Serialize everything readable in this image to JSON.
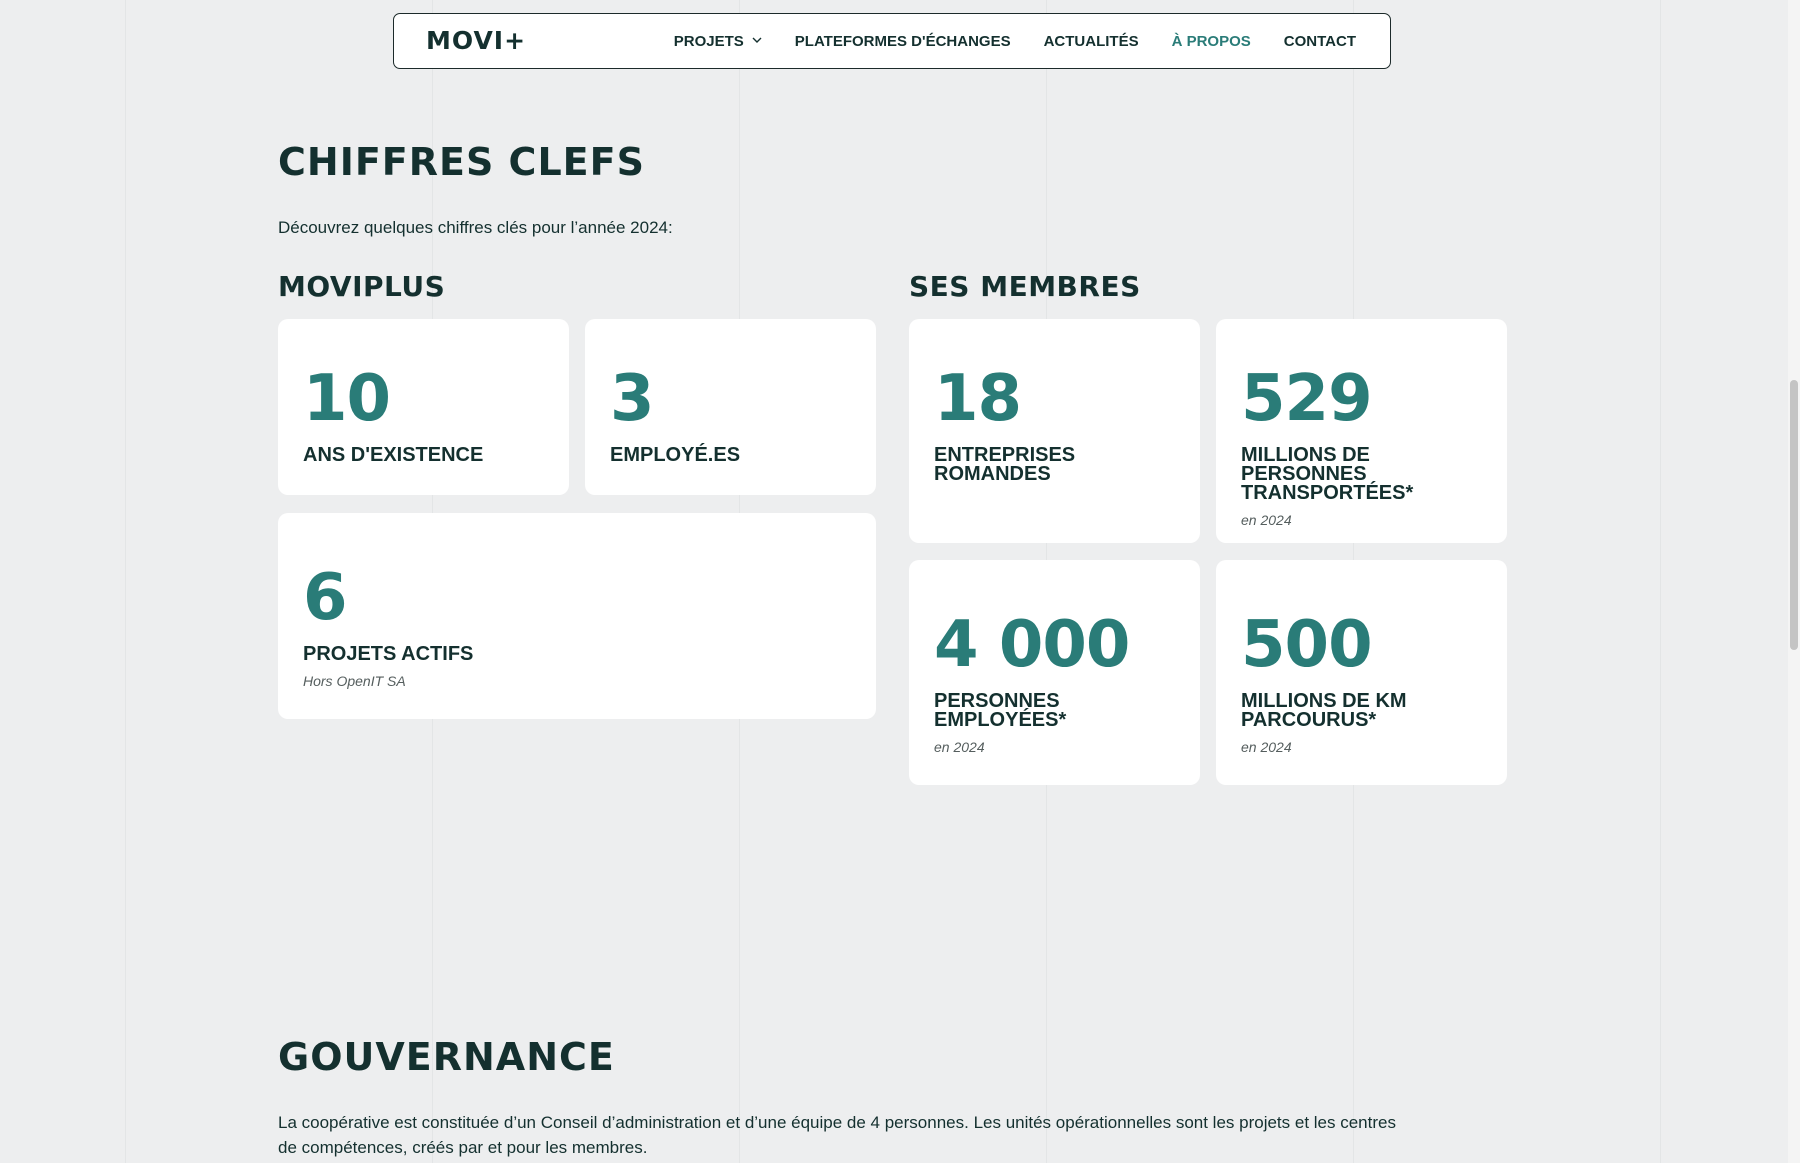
{
  "header": {
    "logo": "MOVI+",
    "nav": [
      {
        "label": "PROJETS",
        "has_dropdown": true,
        "active": false
      },
      {
        "label": "PLATEFORMES D'ÉCHANGES",
        "active": false
      },
      {
        "label": "ACTUALITÉS",
        "active": false
      },
      {
        "label": "À PROPOS",
        "active": true
      },
      {
        "label": "CONTACT",
        "active": false
      }
    ],
    "dropdown_icon": "chevron-down-icon"
  },
  "key_figures": {
    "title": "CHIFFRES CLEFS",
    "intro": "Découvrez quelques chiffres clés pour l’année 2024:",
    "moviplus": {
      "title": "MOVIPLUS",
      "cards": [
        {
          "value": "10",
          "label": "ANS D'EXISTENCE"
        },
        {
          "value": "3",
          "label": "EMPLOYÉ.ES"
        },
        {
          "value": "6",
          "label": "PROJETS ACTIFS",
          "note": "Hors OpenIT SA"
        }
      ]
    },
    "members": {
      "title": "SES MEMBRES",
      "cards": [
        {
          "value": "18",
          "label": "ENTREPRISES ROMANDES"
        },
        {
          "value": "529",
          "label": "MILLIONS DE PERSONNES TRANSPORTÉES*",
          "note": "en 2024"
        },
        {
          "value": "4 000",
          "label": "PERSONNES EMPLOYÉES*",
          "note": "en 2024"
        },
        {
          "value": "500",
          "label": "MILLIONS DE KM PARCOURUS*",
          "note": "en 2024"
        }
      ]
    }
  },
  "governance": {
    "title": "GOUVERNANCE",
    "text": "La coopérative est constituée d’un Conseil d’administration et d’une équipe de 4 personnes. Les unités opérationnelles sont les projets et les centres de compétences, créés par et pour les membres."
  },
  "colors": {
    "accent": "#2a7c78",
    "text": "#14302f",
    "background": "#edeeef",
    "card": "#ffffff"
  }
}
